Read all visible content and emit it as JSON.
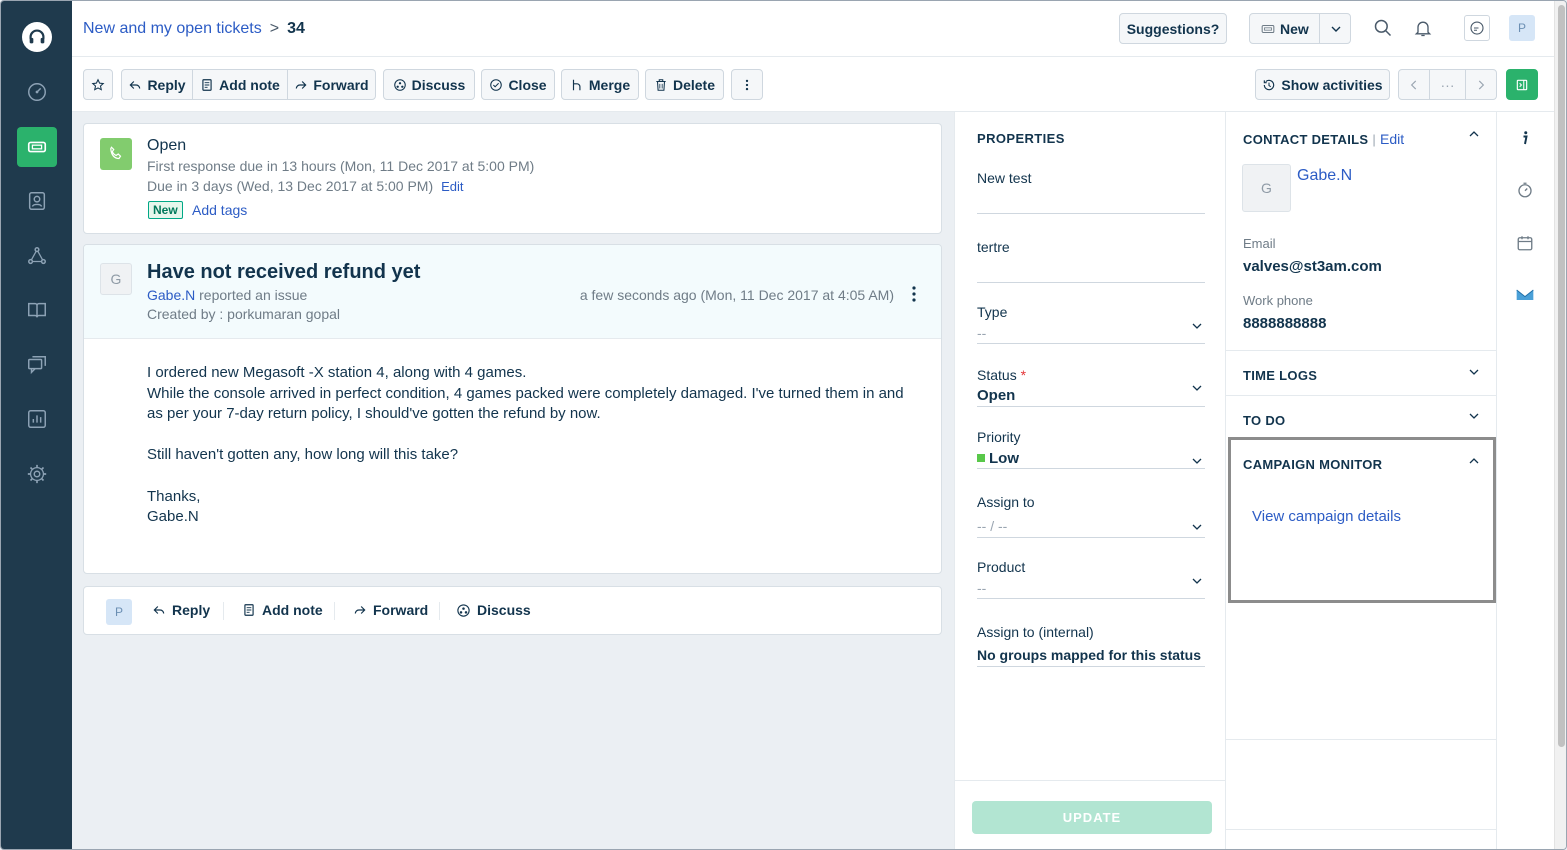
{
  "header": {
    "breadcrumb_link": "New and my open tickets",
    "breadcrumb_sep": ">",
    "ticket_number": "34",
    "suggestions_label": "Suggestions?",
    "new_label": "New",
    "user_initial": "P"
  },
  "toolbar": {
    "reply": "Reply",
    "add_note": "Add note",
    "forward": "Forward",
    "discuss": "Discuss",
    "close": "Close",
    "merge": "Merge",
    "delete": "Delete",
    "show_activities": "Show activities",
    "ellipsis": "···"
  },
  "status_card": {
    "state": "Open",
    "first_response": "First response due in 13 hours (Mon, 11 Dec 2017 at 5:00 PM)",
    "due": "Due in 3 days (Wed, 13 Dec 2017 at 5:00 PM)",
    "edit": "Edit",
    "badge": "New",
    "add_tags": "Add tags"
  },
  "ticket": {
    "avatar_initial": "G",
    "title": "Have not received refund yet",
    "requester": "Gabe.N",
    "reported_text": " reported an issue",
    "created_by": "Created by : porkumaran gopal",
    "time": "a few seconds ago (Mon, 11 Dec 2017 at 4:05 AM)",
    "body": [
      "I ordered new Megasoft -X station 4, along with 4 games.",
      "While the console arrived in perfect condition, 4 games packed were completely damaged. I've turned them in and as per your 7-day return policy, I should've gotten the refund by now.",
      "",
      "Still haven't gotten any, how long will this take?",
      "",
      "Thanks,",
      "Gabe.N"
    ]
  },
  "reply_bar": {
    "avatar_initial": "P",
    "reply": "Reply",
    "add_note": "Add note",
    "forward": "Forward",
    "discuss": "Discuss"
  },
  "properties": {
    "title": "PROPERTIES",
    "field1_label": "New test",
    "field2_label": "tertre",
    "type_label": "Type",
    "type_value": "--",
    "status_label": "Status",
    "status_required": "*",
    "status_value": "Open",
    "priority_label": "Priority",
    "priority_value": "Low",
    "priority_color": "#59c84a",
    "assign_label": "Assign to",
    "assign_value": "-- / --",
    "product_label": "Product",
    "product_value": "--",
    "assign_internal_label": "Assign to (internal)",
    "assign_internal_value": "No groups mapped for this status",
    "update_label": "UPDATE"
  },
  "contact": {
    "title": "CONTACT DETAILS",
    "pipe": "|",
    "edit": "Edit",
    "avatar_initial": "G",
    "name": "Gabe.N",
    "email_label": "Email",
    "email": "valves@st3am.com",
    "phone_label": "Work phone",
    "phone": "8888888888",
    "time_logs": "TIME LOGS",
    "to_do": "TO DO",
    "campaign_monitor": "CAMPAIGN MONITOR",
    "campaign_link": "View campaign details"
  },
  "colors": {
    "nav_bg": "#1f3a4d",
    "accent_green": "#2bb26c",
    "link_blue": "#2c5cc5"
  }
}
